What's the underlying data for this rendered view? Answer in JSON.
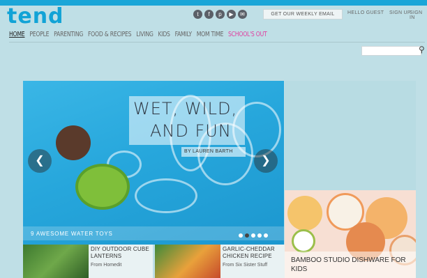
{
  "header": {
    "logo": "tend",
    "email_button": "GET OUR WEEKLY EMAIL",
    "greeting": "HELLO GUEST",
    "sign_up": "SIGN UP",
    "sign_in": "SIGN IN"
  },
  "nav": {
    "items": [
      "HOME",
      "PEOPLE",
      "PARENTING",
      "FOOD & RECIPES",
      "LIVING",
      "KIDS",
      "FAMILY",
      "MOM TIME",
      "SCHOOL'S OUT"
    ]
  },
  "hero": {
    "title_line1": "WET, WILD,",
    "title_line2": "AND FUN",
    "byline": "BY LAUREN BARTH",
    "caption": "9 AWESOME WATER TOYS",
    "prev_arrow": "❮",
    "next_arrow": "❯"
  },
  "cards": [
    {
      "title": "DIY OUTDOOR CUBE LANTERNS",
      "source": "From Homedit"
    },
    {
      "title": "GARLIC-CHEDDAR CHICKEN RECIPE",
      "source": "From Six Sister Stuff"
    }
  ],
  "feature": {
    "title": "BAMBOO STUDIO DISHWARE FOR KIDS"
  },
  "colors": {
    "brand": "#12a3d6",
    "accent_pink": "#e03e9f",
    "background": "#bfdfe6"
  }
}
